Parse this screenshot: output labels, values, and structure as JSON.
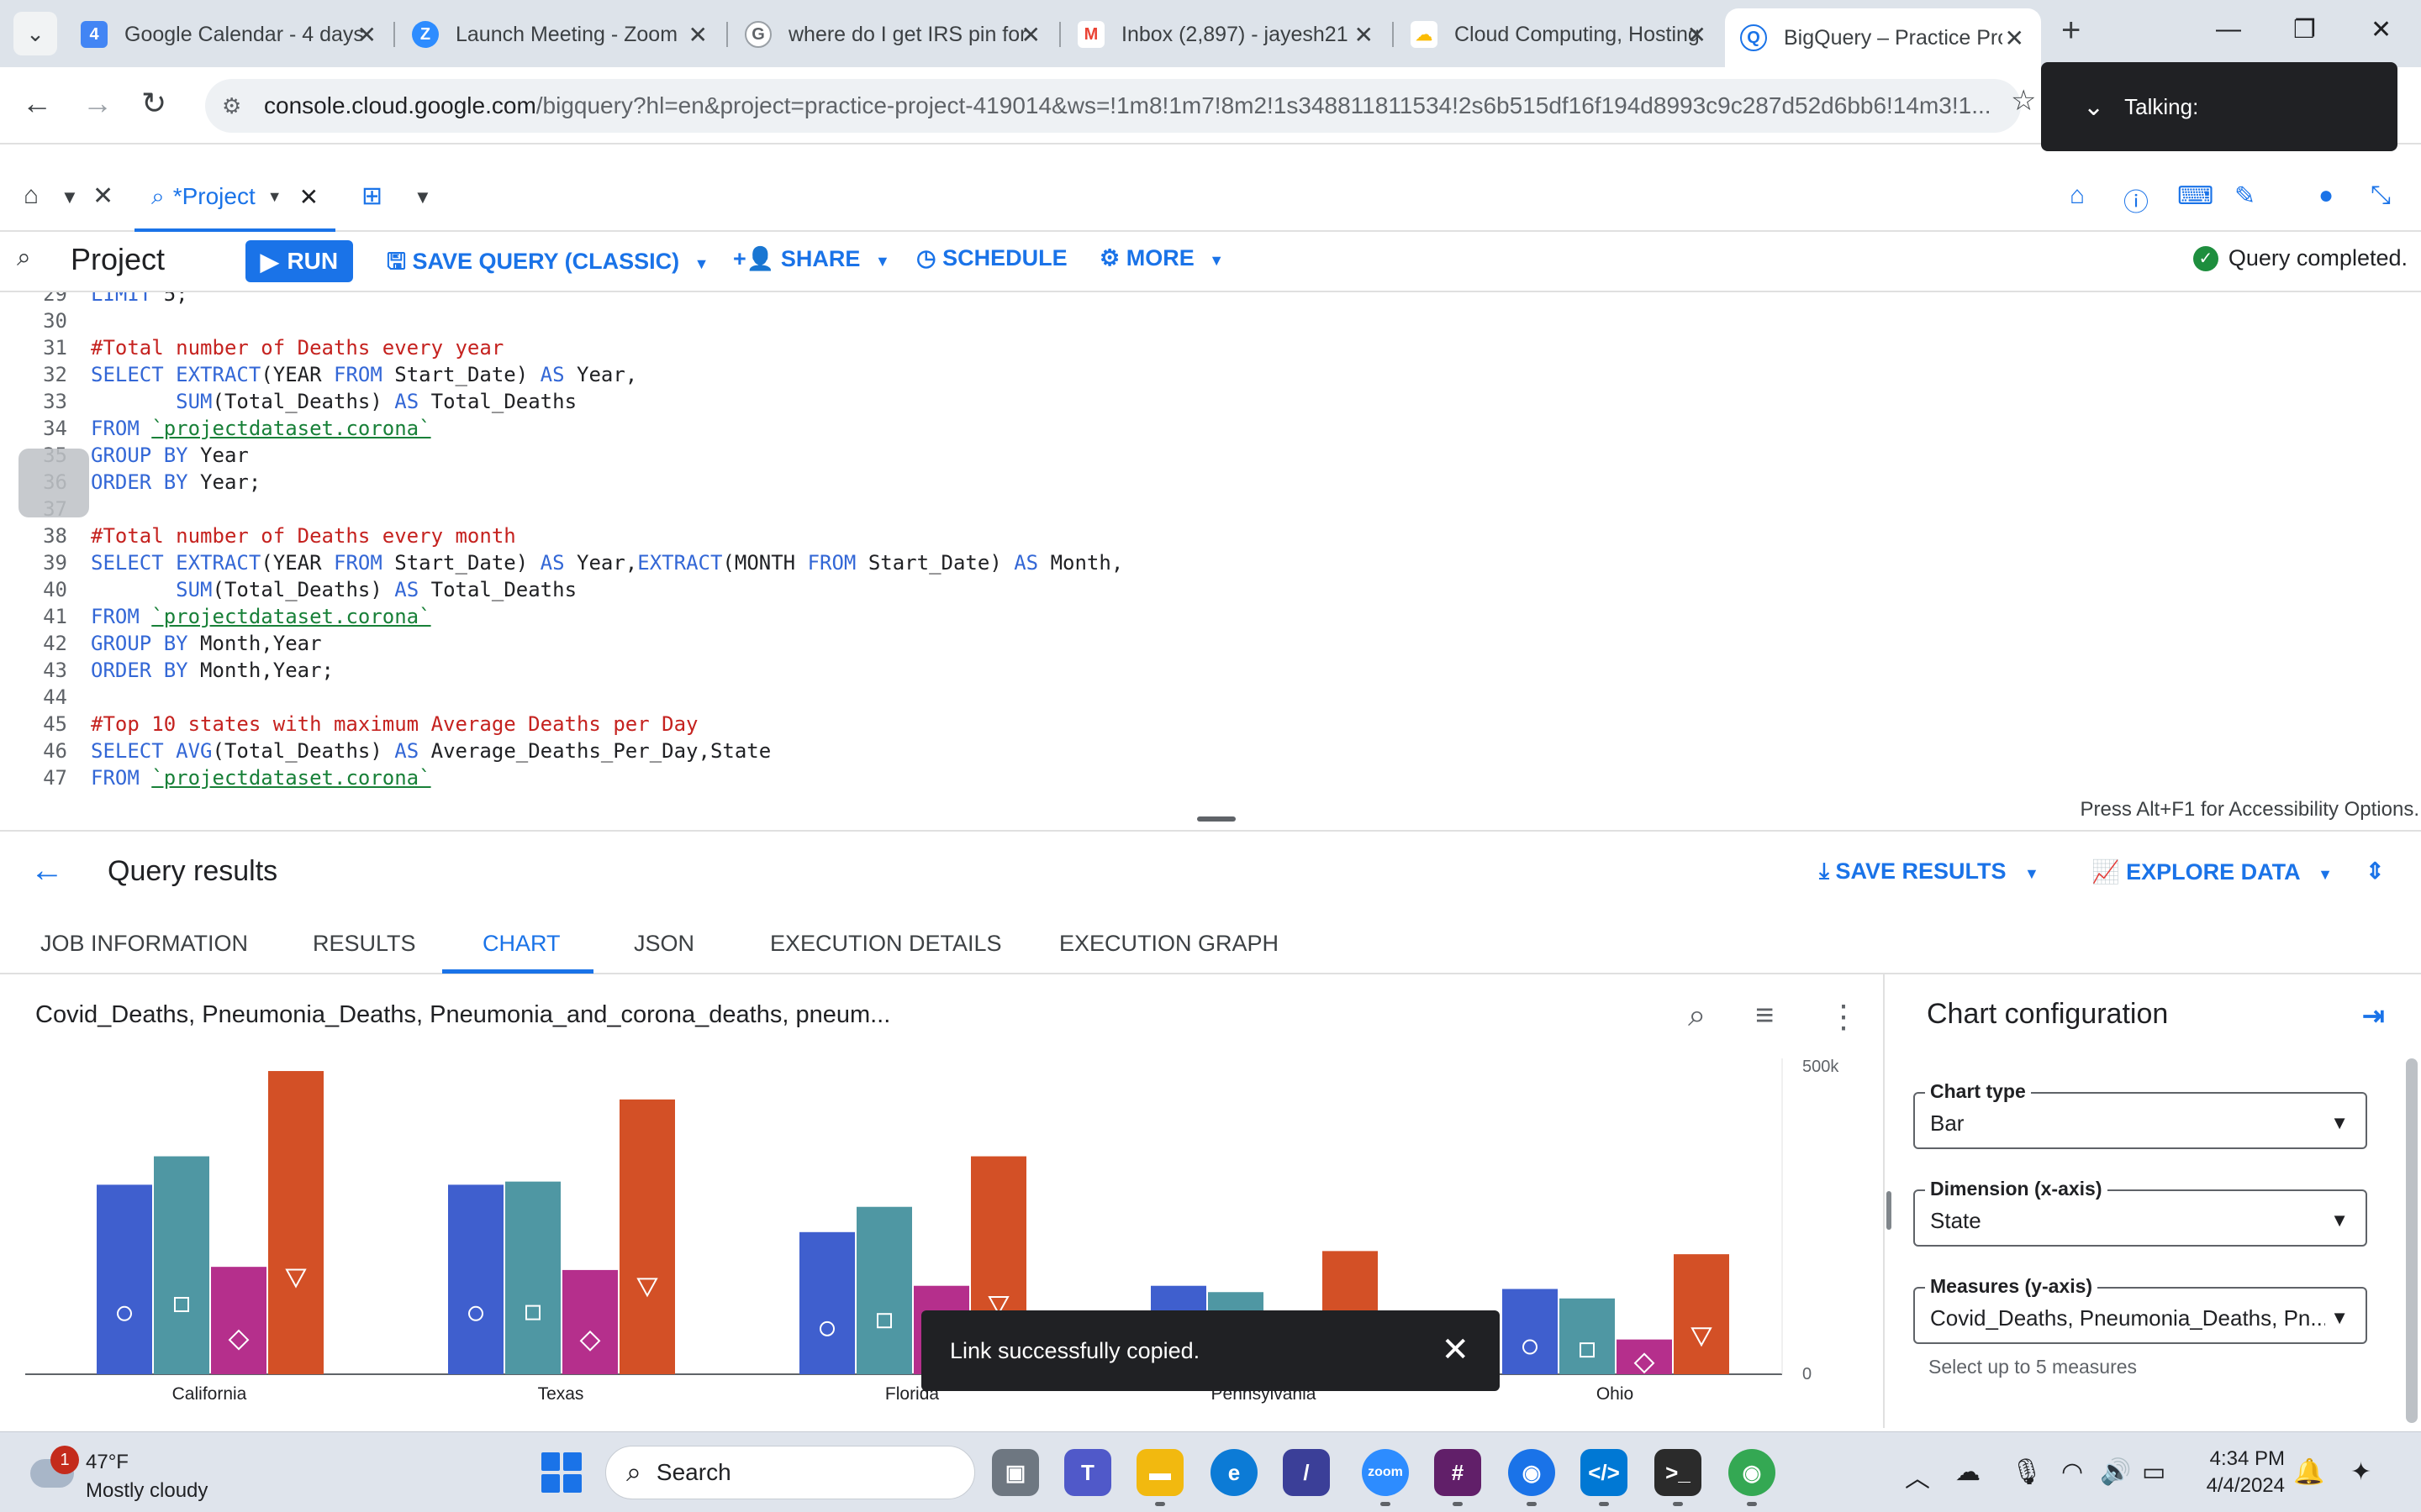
{
  "browser": {
    "tabs": [
      {
        "title": "Google Calendar - 4 days",
        "favicon": "calendar-icon",
        "color": "#4285f4",
        "glyph": "4"
      },
      {
        "title": "Launch Meeting - Zoom",
        "favicon": "zoom-icon",
        "color": "#2d8cff",
        "glyph": "Z"
      },
      {
        "title": "where do I get IRS pin for",
        "favicon": "google-icon",
        "color": "#5f6368",
        "glyph": "G"
      },
      {
        "title": "Inbox (2,897) - jayesh21",
        "favicon": "gmail-icon",
        "color": "#ea4335",
        "glyph": "M"
      },
      {
        "title": "Cloud Computing, Hosting",
        "favicon": "gcloud-icon",
        "color": "#fbbc04",
        "glyph": "☁"
      },
      {
        "title": "BigQuery – Practice Proj",
        "favicon": "bigquery-icon",
        "color": "#1a73e8",
        "glyph": "Q"
      }
    ],
    "url_host": "console.cloud.google.com",
    "url_path": "/bigquery?hl=en&project=practice-project-419014&ws=!1m8!1m7!8m2!1s348811811534!2s6b515df16f194d8993c9c287d52d6bb6!14m3!1..."
  },
  "talking": {
    "label": "Talking:"
  },
  "bq": {
    "tab_label": "*Project",
    "project_title": "Project",
    "run": "RUN",
    "save_query": "SAVE QUERY (CLASSIC)",
    "share": "SHARE",
    "schedule": "SCHEDULE",
    "more": "MORE",
    "status": "Query completed."
  },
  "editor": {
    "lines": [
      {
        "n": "29",
        "html": "<span class=\"kw\">LIMIT</span> 5;"
      },
      {
        "n": "30",
        "html": ""
      },
      {
        "n": "31",
        "html": "<span class=\"cm\">#Total number of Deaths every year</span>"
      },
      {
        "n": "32",
        "html": "<span class=\"kw\">SELECT</span> <span class=\"fn\">EXTRACT</span>(YEAR <span class=\"kw\">FROM</span> Start_Date) <span class=\"kw\">AS</span> Year,"
      },
      {
        "n": "33",
        "html": "       <span class=\"fn\">SUM</span>(Total_Deaths) <span class=\"kw\">AS</span> Total_Deaths"
      },
      {
        "n": "34",
        "html": "<span class=\"kw\">FROM</span> <span class=\"str\">`projectdataset.corona`</span>"
      },
      {
        "n": "35",
        "html": "<span class=\"kw\">GROUP BY</span> Year"
      },
      {
        "n": "36",
        "html": "<span class=\"kw\">ORDER BY</span> Year;"
      },
      {
        "n": "37",
        "html": ""
      },
      {
        "n": "38",
        "html": "<span class=\"cm\">#Total number of Deaths every month</span>"
      },
      {
        "n": "39",
        "html": "<span class=\"kw\">SELECT</span> <span class=\"fn\">EXTRACT</span>(YEAR <span class=\"kw\">FROM</span> Start_Date) <span class=\"kw\">AS</span> Year,<span class=\"fn\">EXTRACT</span>(MONTH <span class=\"kw\">FROM</span> Start_Date) <span class=\"kw\">AS</span> Month,"
      },
      {
        "n": "40",
        "html": "       <span class=\"fn\">SUM</span>(Total_Deaths) <span class=\"kw\">AS</span> Total_Deaths"
      },
      {
        "n": "41",
        "html": "<span class=\"kw\">FROM</span> <span class=\"str\">`projectdataset.corona`</span>"
      },
      {
        "n": "42",
        "html": "<span class=\"kw\">GROUP BY</span> Month,Year"
      },
      {
        "n": "43",
        "html": "<span class=\"kw\">ORDER BY</span> Month,Year;"
      },
      {
        "n": "44",
        "html": ""
      },
      {
        "n": "45",
        "html": "<span class=\"cm\">#Top 10 states with maximum Average Deaths per Day</span>"
      },
      {
        "n": "46",
        "html": "<span class=\"kw\">SELECT</span> <span class=\"fn\">AVG</span>(Total_Deaths) <span class=\"kw\">AS</span> Average_Deaths_Per_Day,State"
      },
      {
        "n": "47",
        "html": "<span class=\"kw\">FROM</span> <span class=\"str\">`projectdataset.corona`</span>"
      }
    ],
    "accessibility_hint": "Press Alt+F1 for Accessibility Options."
  },
  "results": {
    "title": "Query results",
    "save_results": "SAVE RESULTS",
    "explore_data": "EXPLORE DATA",
    "tabs": [
      "JOB INFORMATION",
      "RESULTS",
      "CHART",
      "JSON",
      "EXECUTION DETAILS",
      "EXECUTION GRAPH"
    ],
    "active_tab": "CHART"
  },
  "chart_data": {
    "type": "bar",
    "title": "Covid_Deaths, Pneumonia_Deaths, Pneumonia_and_corona_deaths, pneum...",
    "categories": [
      "California",
      "Texas",
      "Florida",
      "Pennsylvania",
      "Ohio"
    ],
    "series": [
      {
        "color": "#3f5fce",
        "marker": "circle",
        "values": [
          300000,
          300000,
          225000,
          140000,
          135000
        ]
      },
      {
        "color": "#4f97a3",
        "marker": "square",
        "values": [
          345000,
          305000,
          265000,
          130000,
          120000
        ]
      },
      {
        "color": "#b52f8c",
        "marker": "diamond",
        "values": [
          170000,
          165000,
          140000,
          20000,
          55000
        ]
      },
      {
        "color": "#d35026",
        "marker": "triangle-down",
        "values": [
          480000,
          435000,
          345000,
          195000,
          190000
        ]
      }
    ],
    "ylim": [
      0,
      500000
    ],
    "yticks": [
      "500k",
      "0"
    ],
    "xlabel": "",
    "ylabel": "",
    "grid": false
  },
  "chart_config": {
    "title": "Chart configuration",
    "chart_type_label": "Chart type",
    "chart_type_value": "Bar",
    "dimension_label": "Dimension (x-axis)",
    "dimension_value": "State",
    "measures_label": "Measures (y-axis)",
    "measures_value": "Covid_Deaths, Pneumonia_Deaths, Pn...",
    "measures_hint": "Select up to 5 measures"
  },
  "snackbar": {
    "message": "Link successfully copied."
  },
  "taskbar": {
    "weather_temp": "47°F",
    "weather_cond": "Mostly cloudy",
    "weather_badge": "1",
    "search": "Search",
    "time": "4:34 PM",
    "date": "4/4/2024"
  }
}
